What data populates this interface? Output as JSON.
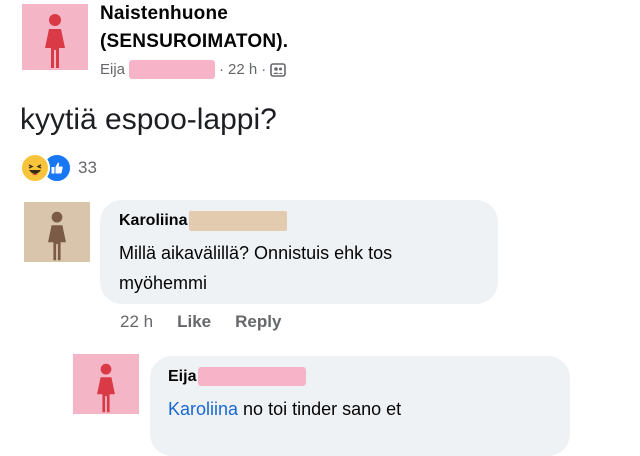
{
  "post": {
    "group_name_line1": "Naistenhuone",
    "group_name_line2": "(SENSUROIMATON).",
    "author": "Eija",
    "time": "22 h",
    "separator": "·",
    "privacy_icon": "group-privacy-icon",
    "text": "kyytiä espoo-lappi?",
    "reaction_icons": [
      "haha-reaction-icon",
      "like-reaction-icon"
    ],
    "reaction_count": "33"
  },
  "comments": [
    {
      "author": "Karoliina",
      "text_line1": "Millä aikavälillä? Onnistuis ehk tos",
      "text_line2": "myöhemmi",
      "time": "22 h",
      "like_label": "Like",
      "reply_label": "Reply"
    },
    {
      "author": "Eija",
      "mention": "Karoliina",
      "text": " no toi tinder sano et"
    }
  ],
  "colors": {
    "pink_avatar": "#f4b6c6",
    "tan_avatar": "#d9c5ac",
    "figure_red": "#d93a46",
    "figure_brown": "#7b5b45",
    "bubble_bg": "#eff2f5",
    "mention_blue": "#1968d2",
    "meta_gray": "#65676b"
  }
}
